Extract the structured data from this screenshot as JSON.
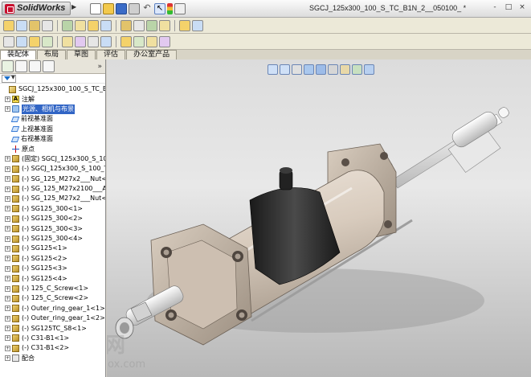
{
  "app": {
    "name": "SolidWorks",
    "document_title": "SGCJ_125x300_100_S_TC_B1N_2__050100_ *",
    "window_controls": [
      "-",
      "□",
      "×"
    ]
  },
  "toolbar": {
    "main_icons": [
      "new-doc-icon",
      "open-folder-icon",
      "save-icon",
      "print-icon",
      "undo-icon",
      "select-arrow-icon",
      "traffic-light-icon",
      "options-icon"
    ],
    "row2_icons": [
      "insert-component-icon",
      "mate-icon",
      "linear-pattern-icon",
      "smart-fastener-icon",
      "move-component-icon",
      "show-hidden-icon",
      "assembly-features-icon",
      "reference-geometry-icon",
      "new-motion-icon",
      "bill-of-materials-icon",
      "exploded-view-icon",
      "explode-line-icon",
      "interference-icon",
      "hole-alignment-icon"
    ],
    "row3_icons": [
      "sketch-icon",
      "smart-dimension-icon",
      "line-icon",
      "rectangle-icon",
      "circle-icon",
      "arc-icon",
      "spline-icon",
      "point-icon",
      "trim-icon",
      "offset-icon",
      "mirror-icon",
      "display-relations-icon"
    ]
  },
  "tabs": [
    {
      "label": "装配体",
      "active": true
    },
    {
      "label": "布局",
      "active": false
    },
    {
      "label": "草图",
      "active": false
    },
    {
      "label": "评估",
      "active": false
    },
    {
      "label": "办公室产品",
      "active": false
    }
  ],
  "panel": {
    "tab_icons": [
      "feature-manager-icon",
      "property-manager-icon",
      "configuration-manager-icon",
      "dim-xpert-icon"
    ],
    "expand_label": "»",
    "tree": [
      {
        "text": "SGCJ_125x300_100_S_TC_B1N_2",
        "icon": "asm",
        "exp": "",
        "indent": 0,
        "selected": false
      },
      {
        "text": "注解",
        "icon": "note",
        "exp": "+",
        "indent": 1,
        "selected": false
      },
      {
        "text": "光源、相机与布景",
        "icon": "light",
        "exp": "+",
        "indent": 1,
        "selected": true
      },
      {
        "text": "前视基准面",
        "icon": "plane",
        "exp": "",
        "indent": 1,
        "selected": false
      },
      {
        "text": "上视基准面",
        "icon": "plane",
        "exp": "",
        "indent": 1,
        "selected": false
      },
      {
        "text": "右视基准面",
        "icon": "plane",
        "exp": "",
        "indent": 1,
        "selected": false
      },
      {
        "text": "原点",
        "icon": "origin",
        "exp": "",
        "indent": 1,
        "selected": false
      },
      {
        "text": "(固定) SGCJ_125x300_S_10",
        "icon": "part",
        "exp": "+",
        "indent": 1,
        "selected": false
      },
      {
        "text": "(-) SGCJ_125x300_S_100_T",
        "icon": "part",
        "exp": "+",
        "indent": 1,
        "selected": false
      },
      {
        "text": "(-) SG_125_M27x2___Nut<1",
        "icon": "part",
        "exp": "+",
        "indent": 1,
        "selected": false
      },
      {
        "text": "(-) SG_125_M27x2100___A_",
        "icon": "part",
        "exp": "+",
        "indent": 1,
        "selected": false
      },
      {
        "text": "(-) SG_125_M27x2___Nut<2",
        "icon": "part",
        "exp": "+",
        "indent": 1,
        "selected": false
      },
      {
        "text": "(-) SG125_300<1>",
        "icon": "part",
        "exp": "+",
        "indent": 1,
        "selected": false
      },
      {
        "text": "(-) SG125_300<2>",
        "icon": "part",
        "exp": "+",
        "indent": 1,
        "selected": false
      },
      {
        "text": "(-) SG125_300<3>",
        "icon": "part",
        "exp": "+",
        "indent": 1,
        "selected": false
      },
      {
        "text": "(-) SG125_300<4>",
        "icon": "part",
        "exp": "+",
        "indent": 1,
        "selected": false
      },
      {
        "text": "(-) SG125<1>",
        "icon": "part",
        "exp": "+",
        "indent": 1,
        "selected": false
      },
      {
        "text": "(-) SG125<2>",
        "icon": "part",
        "exp": "+",
        "indent": 1,
        "selected": false
      },
      {
        "text": "(-) SG125<3>",
        "icon": "part",
        "exp": "+",
        "indent": 1,
        "selected": false
      },
      {
        "text": "(-) SG125<4>",
        "icon": "part",
        "exp": "+",
        "indent": 1,
        "selected": false
      },
      {
        "text": "(-) 125_C_Screw<1>",
        "icon": "part",
        "exp": "+",
        "indent": 1,
        "selected": false
      },
      {
        "text": "(-) 125_C_Screw<2>",
        "icon": "part",
        "exp": "+",
        "indent": 1,
        "selected": false
      },
      {
        "text": "(-) Outer_ring_gear_1<1>",
        "icon": "part",
        "exp": "+",
        "indent": 1,
        "selected": false
      },
      {
        "text": "(-) Outer_ring_gear_1<2>",
        "icon": "part",
        "exp": "+",
        "indent": 1,
        "selected": false
      },
      {
        "text": "(-) SG125TC_S8<1>",
        "icon": "part",
        "exp": "+",
        "indent": 1,
        "selected": false
      },
      {
        "text": "(-) C31-B1<1>",
        "icon": "part",
        "exp": "+",
        "indent": 1,
        "selected": false
      },
      {
        "text": "(-) C31-B1<2>",
        "icon": "part",
        "exp": "+",
        "indent": 1,
        "selected": false
      },
      {
        "text": "配合",
        "icon": "mate",
        "exp": "+",
        "indent": 1,
        "selected": false
      }
    ]
  },
  "viewport": {
    "view_tools": [
      "zoom-to-fit-icon",
      "zoom-area-icon",
      "previous-view-icon",
      "section-view-icon",
      "view-orientation-icon",
      "display-style-icon",
      "hide-show-icon",
      "edit-appearance-icon",
      "scene-icon"
    ]
  },
  "watermark": {
    "text": "三维网",
    "url": "www.3dmox.com"
  },
  "colors": {
    "selection": "#3165c5",
    "viewport_top": "#dcdcdc",
    "cylinder_body": "#d9cfc5",
    "rod": "#eeeeee",
    "clamp": "#2a2a2a"
  }
}
